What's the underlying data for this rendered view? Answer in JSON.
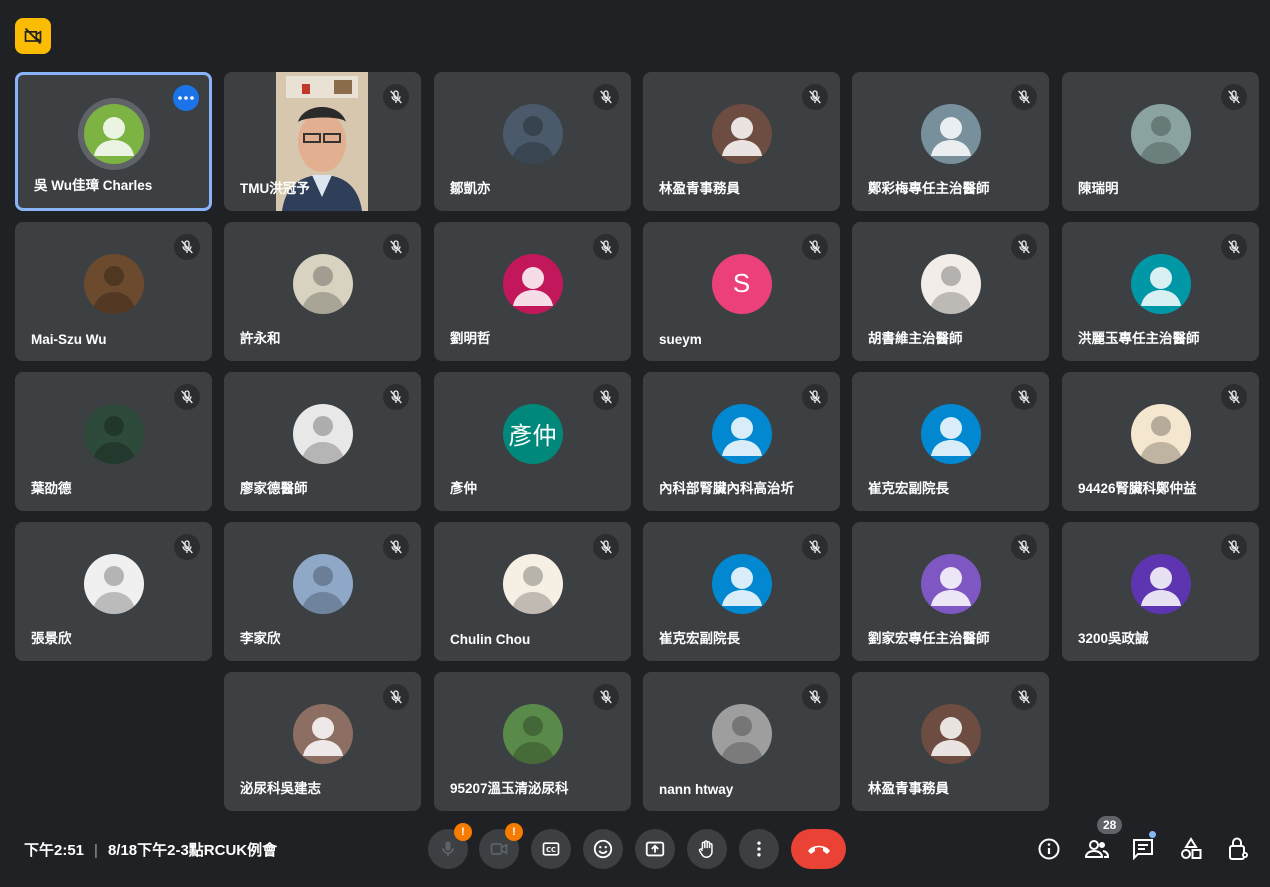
{
  "top_badge": {
    "icon": "no-recording-icon",
    "color": "#fbbc04"
  },
  "participants": [
    {
      "name": "吳 Wu佳璋 Charles",
      "avatar": "person",
      "color": "#7cb342",
      "active": true
    },
    {
      "name": "TMU洪冠予",
      "avatar": "video"
    },
    {
      "name": "鄒凱亦",
      "avatar": "photo",
      "color": "#4a5a6a"
    },
    {
      "name": "林盈青事務員",
      "avatar": "person",
      "color": "#6d4c41"
    },
    {
      "name": "鄭彩梅專任主治醫師",
      "avatar": "person",
      "color": "#78909c"
    },
    {
      "name": "陳瑞明",
      "avatar": "photo",
      "color": "#8aa3a0"
    },
    {
      "name": "Mai-Szu Wu",
      "avatar": "photo",
      "color": "#6b4a2e"
    },
    {
      "name": "許永和",
      "avatar": "photo",
      "color": "#d8d2c0"
    },
    {
      "name": "劉明哲",
      "avatar": "person",
      "color": "#c2185b"
    },
    {
      "name": "sueym",
      "avatar": "letter",
      "letter": "S",
      "color": "#ec407a"
    },
    {
      "name": "胡書維主治醫師",
      "avatar": "photo",
      "color": "#f2ede8"
    },
    {
      "name": "洪麗玉專任主治醫師",
      "avatar": "person",
      "color": "#0097a7"
    },
    {
      "name": "葉劭德",
      "avatar": "photo",
      "color": "#2e4a3a"
    },
    {
      "name": "廖家德醫師",
      "avatar": "photo",
      "color": "#e8e8e8"
    },
    {
      "name": "彥仲",
      "avatar": "letter",
      "letter": "彥仲",
      "color": "#00897b"
    },
    {
      "name": "內科部腎臟內科高治圻",
      "avatar": "person",
      "color": "#0288d1"
    },
    {
      "name": "崔克宏副院長",
      "avatar": "person",
      "color": "#0288d1"
    },
    {
      "name": "94426腎臟科鄭仲益",
      "avatar": "photo",
      "color": "#f5e6d0"
    },
    {
      "name": "張景欣",
      "avatar": "photo",
      "color": "#f0f0f0"
    },
    {
      "name": "李家欣",
      "avatar": "photo",
      "color": "#8fa8c8"
    },
    {
      "name": "Chulin Chou",
      "avatar": "photo",
      "color": "#f6efe4"
    },
    {
      "name": "崔克宏副院長",
      "avatar": "person",
      "color": "#0288d1"
    },
    {
      "name": "劉家宏專任主治醫師",
      "avatar": "person",
      "color": "#7e57c2"
    },
    {
      "name": "3200吳政誠",
      "avatar": "person",
      "color": "#5e35b1"
    },
    {
      "name": "泌尿科吳建志",
      "avatar": "person",
      "color": "#8d6e63"
    },
    {
      "name": "95207溫玉清泌尿科",
      "avatar": "photo",
      "color": "#5a8a4a"
    },
    {
      "name": "nann htway",
      "avatar": "photo",
      "color": "#9e9e9e"
    },
    {
      "name": "林盈青事務員",
      "avatar": "person",
      "color": "#6d4c41"
    }
  ],
  "footer": {
    "time": "下午2:51",
    "separator": "|",
    "meeting_title": "8/18下午2-3點RCUK例會",
    "warning_mark": "!",
    "people_count": "28"
  }
}
